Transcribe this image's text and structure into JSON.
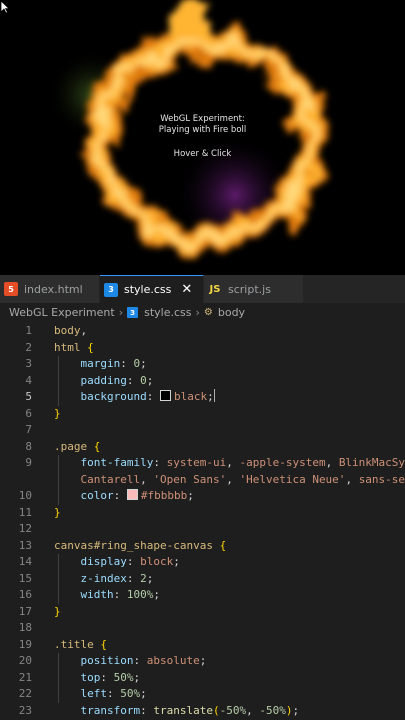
{
  "preview": {
    "line1": "WebGL Experiment:",
    "line2": "Playing with Fire boll",
    "line3": "Hover & Click",
    "colors": {
      "fire_outer": "#ff9a1a",
      "fire_inner": "#ffd46a",
      "glow_green": "#3d5a1e",
      "glow_purple": "#5a1e6b"
    }
  },
  "tabs": [
    {
      "label": "index.html",
      "icon": "html5-icon"
    },
    {
      "label": "style.css",
      "icon": "css3-icon",
      "active": true
    },
    {
      "label": "script.js",
      "icon": "js-icon",
      "icon_text": "JS"
    }
  ],
  "breadcrumb": {
    "folder": "WebGL Experiment",
    "file": "style.css",
    "symbol": "body"
  },
  "editor": {
    "current_line": 5,
    "lines": [
      {
        "n": "1",
        "tokens": [
          [
            "sel",
            "body"
          ],
          [
            "p",
            ","
          ]
        ]
      },
      {
        "n": "2",
        "tokens": [
          [
            "sel",
            "html"
          ],
          [
            "p",
            " "
          ],
          [
            "br",
            "{"
          ]
        ]
      },
      {
        "n": "3",
        "tokens": [
          [
            "p",
            "    "
          ],
          [
            "prop",
            "margin"
          ],
          [
            "p",
            ": "
          ],
          [
            "num",
            "0"
          ],
          [
            "p",
            ";"
          ]
        ]
      },
      {
        "n": "4",
        "tokens": [
          [
            "p",
            "    "
          ],
          [
            "prop",
            "padding"
          ],
          [
            "p",
            ": "
          ],
          [
            "num",
            "0"
          ],
          [
            "p",
            ";"
          ]
        ]
      },
      {
        "n": "5",
        "tokens": [
          [
            "p",
            "    "
          ],
          [
            "prop",
            "background"
          ],
          [
            "p",
            ": "
          ],
          [
            "swatch",
            "#000000"
          ],
          [
            "val",
            "black"
          ],
          [
            "p",
            ";"
          ],
          [
            "caret",
            ""
          ]
        ]
      },
      {
        "n": "6",
        "tokens": [
          [
            "br",
            "}"
          ]
        ]
      },
      {
        "n": "7",
        "tokens": []
      },
      {
        "n": "8",
        "tokens": [
          [
            "sel",
            ".page"
          ],
          [
            "p",
            " "
          ],
          [
            "br",
            "{"
          ]
        ]
      },
      {
        "n": "9",
        "tokens": [
          [
            "p",
            "    "
          ],
          [
            "prop",
            "font-family"
          ],
          [
            "p",
            ": "
          ],
          [
            "val",
            "system-ui"
          ],
          [
            "p",
            ", "
          ],
          [
            "val",
            "-apple-system"
          ],
          [
            "p",
            ", "
          ],
          [
            "val",
            "BlinkMacSy"
          ]
        ]
      },
      {
        "n": "",
        "tokens": [
          [
            "p",
            "    "
          ],
          [
            "val",
            "Cantarell"
          ],
          [
            "p",
            ", "
          ],
          [
            "val",
            "'Open Sans'"
          ],
          [
            "p",
            ", "
          ],
          [
            "val",
            "'Helvetica Neue'"
          ],
          [
            "p",
            ", "
          ],
          [
            "val",
            "sans-se"
          ]
        ]
      },
      {
        "n": "10",
        "tokens": [
          [
            "p",
            "    "
          ],
          [
            "prop",
            "color"
          ],
          [
            "p",
            ": "
          ],
          [
            "swatch",
            "#fbbbbb"
          ],
          [
            "val",
            "#fbbbbb"
          ],
          [
            "p",
            ";"
          ]
        ]
      },
      {
        "n": "11",
        "tokens": [
          [
            "br",
            "}"
          ]
        ]
      },
      {
        "n": "12",
        "tokens": []
      },
      {
        "n": "13",
        "tokens": [
          [
            "sel",
            "canvas#ring_shape-canvas"
          ],
          [
            "p",
            " "
          ],
          [
            "br",
            "{"
          ]
        ]
      },
      {
        "n": "14",
        "tokens": [
          [
            "p",
            "    "
          ],
          [
            "prop",
            "display"
          ],
          [
            "p",
            ": "
          ],
          [
            "val",
            "block"
          ],
          [
            "p",
            ";"
          ]
        ]
      },
      {
        "n": "15",
        "tokens": [
          [
            "p",
            "    "
          ],
          [
            "prop",
            "z-index"
          ],
          [
            "p",
            ": "
          ],
          [
            "num",
            "2"
          ],
          [
            "p",
            ";"
          ]
        ]
      },
      {
        "n": "16",
        "tokens": [
          [
            "p",
            "    "
          ],
          [
            "prop",
            "width"
          ],
          [
            "p",
            ": "
          ],
          [
            "num",
            "100%"
          ],
          [
            "p",
            ";"
          ]
        ]
      },
      {
        "n": "17",
        "tokens": [
          [
            "br",
            "}"
          ]
        ]
      },
      {
        "n": "18",
        "tokens": []
      },
      {
        "n": "19",
        "tokens": [
          [
            "sel",
            ".title"
          ],
          [
            "p",
            " "
          ],
          [
            "br",
            "{"
          ]
        ]
      },
      {
        "n": "20",
        "tokens": [
          [
            "p",
            "    "
          ],
          [
            "prop",
            "position"
          ],
          [
            "p",
            ": "
          ],
          [
            "val",
            "absolute"
          ],
          [
            "p",
            ";"
          ]
        ]
      },
      {
        "n": "21",
        "tokens": [
          [
            "p",
            "    "
          ],
          [
            "prop",
            "top"
          ],
          [
            "p",
            ": "
          ],
          [
            "num",
            "50%"
          ],
          [
            "p",
            ";"
          ]
        ]
      },
      {
        "n": "22",
        "tokens": [
          [
            "p",
            "    "
          ],
          [
            "prop",
            "left"
          ],
          [
            "p",
            ": "
          ],
          [
            "num",
            "50%"
          ],
          [
            "p",
            ";"
          ]
        ]
      },
      {
        "n": "23",
        "tokens": [
          [
            "p",
            "    "
          ],
          [
            "prop",
            "transform"
          ],
          [
            "p",
            ": "
          ],
          [
            "fn",
            "translate"
          ],
          [
            "br",
            "("
          ],
          [
            "num",
            "-50%"
          ],
          [
            "p",
            ", "
          ],
          [
            "num",
            "-50%"
          ],
          [
            "br",
            ")"
          ],
          [
            "p",
            ";"
          ]
        ]
      }
    ]
  }
}
